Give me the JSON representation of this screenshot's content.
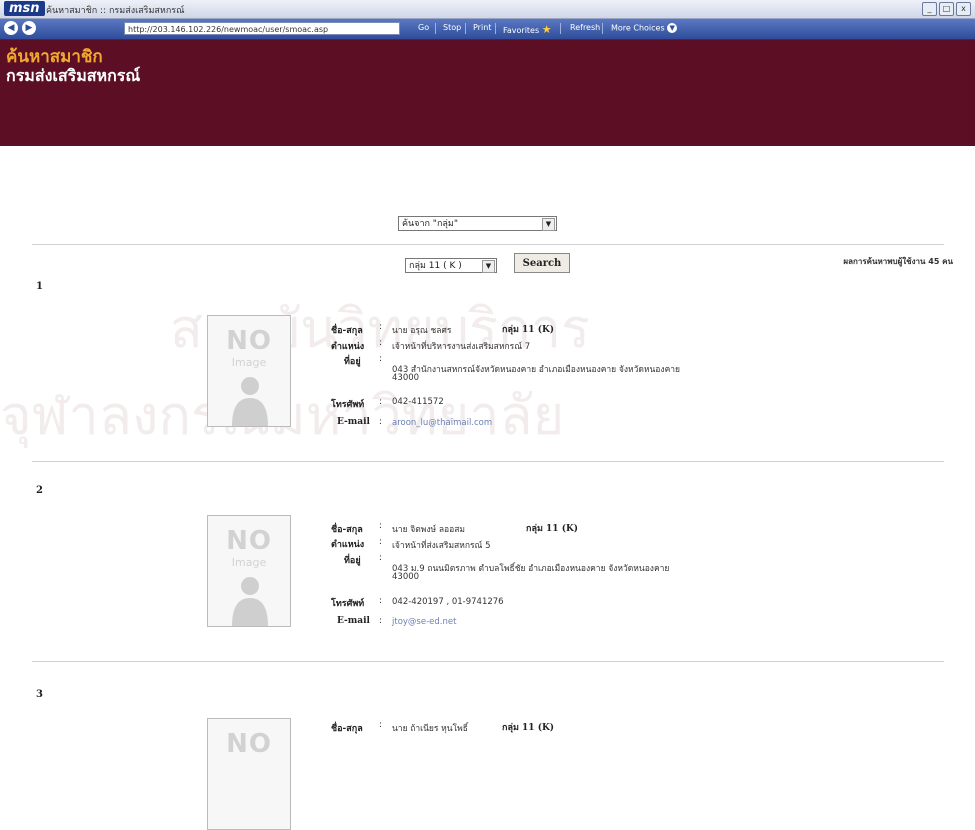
{
  "browser": {
    "logo": "msn",
    "title": "ค้นหาสมาชิก :: กรมส่งเสริมสหกรณ์",
    "url": "http://203.146.102.226/newmoac/user/smoac.asp",
    "toolbar": [
      "Go",
      "Stop",
      "Print",
      "Favorites",
      "Refresh",
      "More Choices"
    ],
    "window_buttons": [
      "_",
      "□",
      "x"
    ]
  },
  "header": {
    "title": "ค้นหาสมาชิก",
    "subtitle": "กรมส่งเสริมสหกรณ์",
    "colors": {
      "background": "#5c0f24",
      "title": "#f0a830",
      "subtitle": "#ffffff"
    }
  },
  "search": {
    "filter_selected": "ค้นจาก \"กลุ่ม\"",
    "group_selected": "กลุ่ม 11 ( K )",
    "search_label": "Search"
  },
  "results": {
    "summary": "ผลการค้นหาพบผู้ใช้งาน 45 คน"
  },
  "photo": {
    "no": "NO",
    "image": "Image"
  },
  "labels": {
    "name": "ชื่อ-สกุล",
    "position": "ตำแหน่ง",
    "address": "ที่อยู่",
    "phone": "โทรศัพท์",
    "email": "E-mail",
    "colon": ":"
  },
  "members": [
    {
      "index": "1",
      "name": "นาย อรุณ ชลศร",
      "group": "กลุ่ม 11 (K)",
      "position": "เจ้าหน้าที่บริหารงานส่งเสริมสหกรณ์ 7",
      "address_line1": "043 สำนักงานสหกรณ์จังหวัดหนองคาย อำเภอเมืองหนองคาย จังหวัดหนองคาย",
      "address_line2": "43000",
      "phone": "042-411572",
      "email": "aroon_lu@thaimail.com"
    },
    {
      "index": "2",
      "name": "นาย จิตพงษ์ ลออสม",
      "group": "กลุ่ม 11 (K)",
      "position": "เจ้าหน้าที่ส่งเสริมสหกรณ์ 5",
      "address_line1": "043 ม.9 ถนนมิตรภาพ ตำบลโพธิ์ชัย อำเภอเมืองหนองคาย จังหวัดหนองคาย",
      "address_line2": "43000",
      "phone": "042-420197 , 01-9741276",
      "email": "jtoy@se-ed.net"
    },
    {
      "index": "3",
      "name": "นาย ถ้าเนียร หุนโพธิ์",
      "group": "กลุ่ม 11 (K)"
    }
  ],
  "watermark": {
    "line1": "สถาบันวิทยบริการ",
    "line2": "จุฬาลงกรณ์มหาวิทยาลัย"
  }
}
